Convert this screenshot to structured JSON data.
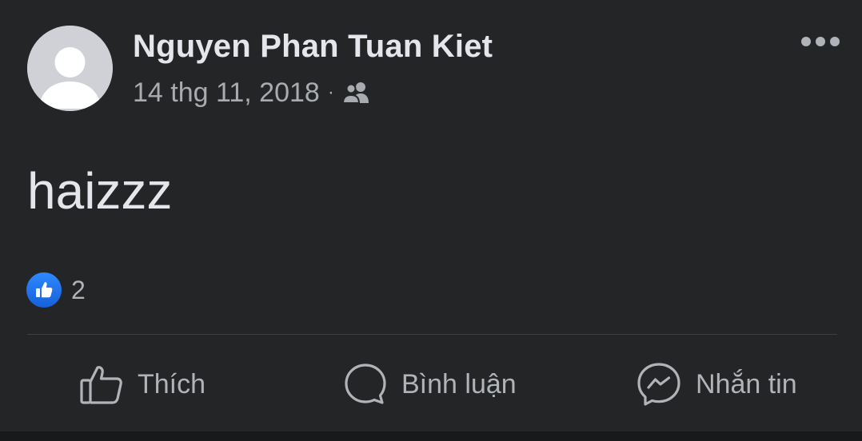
{
  "post": {
    "author": "Nguyen Phan Tuan Kiet",
    "timestamp": "14 thg 11, 2018",
    "separator": "·",
    "audience_icon": "friends-icon",
    "content": "haizzz",
    "reactions": {
      "icon": "like-icon",
      "count": "2"
    }
  },
  "actions": [
    {
      "label": "Thích",
      "icon": "thumbs-up-icon"
    },
    {
      "label": "Bình luận",
      "icon": "comment-icon"
    },
    {
      "label": "Nhắn tin",
      "icon": "messenger-icon"
    }
  ],
  "colors": {
    "background": "#242526",
    "text_primary": "#e4e6eb",
    "text_secondary": "#b0b3b8",
    "like_blue": "#1877f2",
    "divider": "#3e4042"
  }
}
